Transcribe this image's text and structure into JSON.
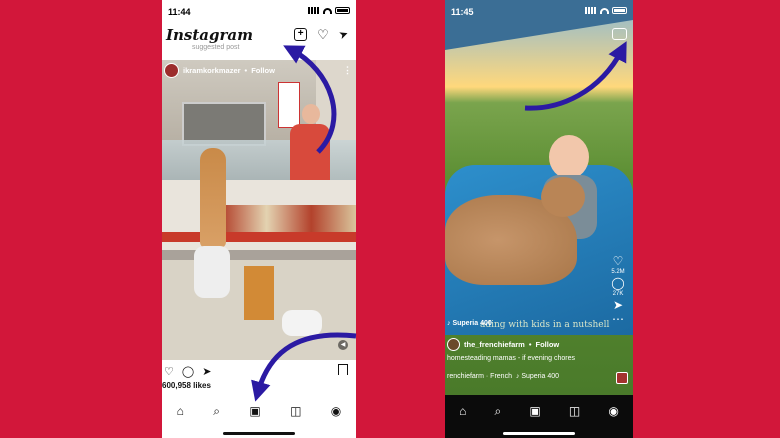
{
  "left_phone": {
    "status": {
      "time": "11:44"
    },
    "header": {
      "logo": "Instagram",
      "faded_text": "suggested post"
    },
    "header_icons": {
      "new_post": "new-post-icon",
      "activity": "heart-icon",
      "messages": "send-icon"
    },
    "post": {
      "username": "ikramkorkmazer",
      "separator": "•",
      "follow_label": "Follow",
      "more_label": "⋮",
      "likes": "600,958 likes"
    },
    "nav": [
      "home-icon",
      "search-icon",
      "reels-icon",
      "shop-icon",
      "profile-icon"
    ]
  },
  "right_phone": {
    "status": {
      "time": "11:45"
    },
    "reel": {
      "caption_overlay": "ading with kids in a nutshell",
      "music_overlay": "Superia 400",
      "username": "the_frenchiefarm",
      "separator": "•",
      "follow_label": "Follow",
      "description": "homesteading mamas - if evening chores",
      "meta_user": "renchiefarm · French",
      "meta_music": "Superia 400",
      "likes_count": "5.2M",
      "comments_count": "27K"
    },
    "nav": [
      "home-icon",
      "search-icon",
      "reels-icon",
      "shop-icon",
      "profile-icon"
    ]
  },
  "colors": {
    "background": "#d2173a",
    "arrow": "#2b1aa3",
    "ig_blue": "#0095f6"
  }
}
